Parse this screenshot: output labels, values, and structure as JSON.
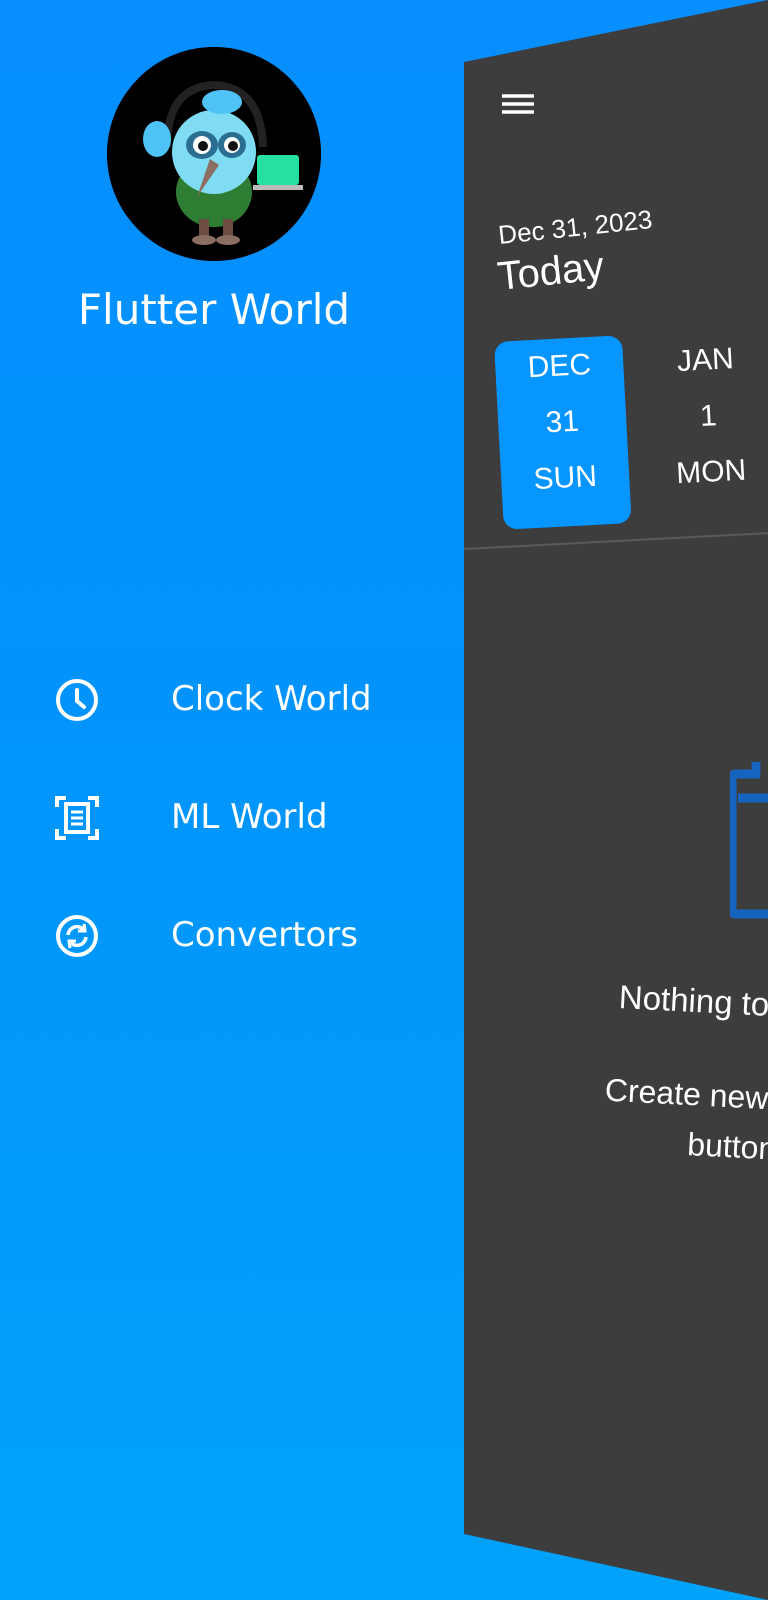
{
  "drawer": {
    "app_name": "Flutter World",
    "items": [
      {
        "label": "Clock World",
        "icon": "clock-icon"
      },
      {
        "label": "ML World",
        "icon": "document-scan-icon"
      },
      {
        "label": "Convertors",
        "icon": "sync-icon"
      }
    ]
  },
  "main": {
    "date": "Dec 31, 2023",
    "today": "Today",
    "days": [
      {
        "month": "DEC",
        "day": "31",
        "weekday": "SUN",
        "selected": true
      },
      {
        "month": "JAN",
        "day": "1",
        "weekday": "MON",
        "selected": false
      }
    ],
    "empty_title": "Nothing to",
    "empty_subtitle_line1": "Create new ta",
    "empty_subtitle_line2": "button"
  },
  "colors": {
    "accent": "#0795ff",
    "panel": "#3d3d3d",
    "empty_icon": "#1976d2"
  }
}
